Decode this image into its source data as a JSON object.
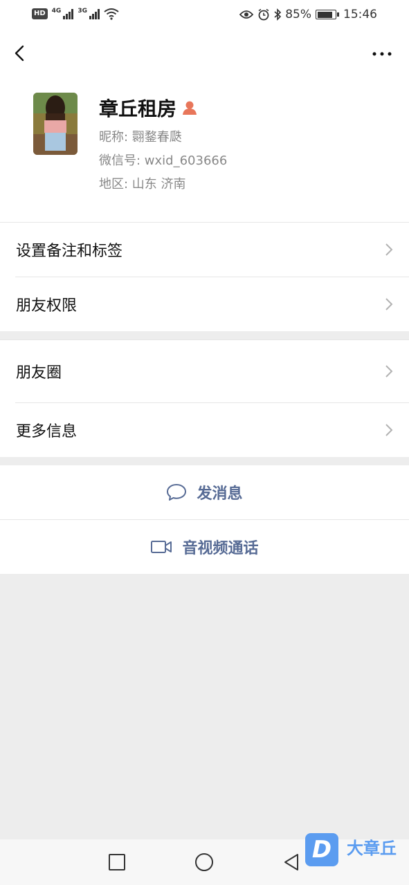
{
  "status_bar": {
    "left_badge": "HD",
    "network_1": "4G",
    "network_2": "3G",
    "battery_percent": "85%",
    "time": "15:46",
    "battery_level": 0.85
  },
  "header": {
    "back_icon": "chevron-left-icon",
    "more_icon": "more-dots-icon"
  },
  "profile": {
    "name": "章丘租房",
    "gender_icon": "female-icon",
    "nickname": "昵称: 翾鍪春瓞",
    "wechat_id": "微信号: wxid_603666",
    "region": "地区: 山东  济南"
  },
  "menu_group_1": [
    {
      "label": "设置备注和标签"
    },
    {
      "label": "朋友权限"
    }
  ],
  "menu_group_2": [
    {
      "label": "朋友圈"
    },
    {
      "label": "更多信息"
    }
  ],
  "actions": {
    "message": "发消息",
    "call": "音视频通话"
  },
  "watermark": {
    "logo_letter": "D",
    "text": "大章丘"
  },
  "colors": {
    "background": "#ededed",
    "link_blue": "#576b95",
    "gender_orange": "#e8765a",
    "watermark_blue": "#5b9cf0"
  }
}
